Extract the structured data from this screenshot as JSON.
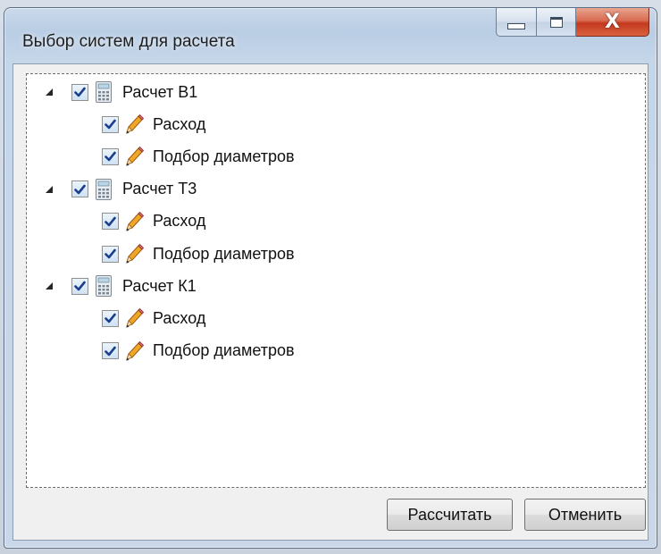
{
  "window": {
    "title": "Выбор систем для расчета"
  },
  "caption_buttons": {
    "close_glyph": "X"
  },
  "tree": {
    "nodes": [
      {
        "label": "Расчет В1",
        "expanded": true,
        "checked": true,
        "icon": "calculator-icon",
        "children": [
          {
            "label": "Расход",
            "checked": true,
            "icon": "pencil-icon"
          },
          {
            "label": "Подбор диаметров",
            "checked": true,
            "icon": "pencil-icon"
          }
        ]
      },
      {
        "label": "Расчет Т3",
        "expanded": true,
        "checked": true,
        "icon": "calculator-icon",
        "children": [
          {
            "label": "Расход",
            "checked": true,
            "icon": "pencil-icon"
          },
          {
            "label": "Подбор диаметров",
            "checked": true,
            "icon": "pencil-icon"
          }
        ]
      },
      {
        "label": "Расчет К1",
        "expanded": true,
        "checked": true,
        "icon": "calculator-icon",
        "children": [
          {
            "label": "Расход",
            "checked": true,
            "icon": "pencil-icon"
          },
          {
            "label": "Подбор диаметров",
            "checked": true,
            "icon": "pencil-icon"
          }
        ]
      }
    ]
  },
  "buttons": {
    "calculate_label": "Рассчитать",
    "cancel_label": "Отменить"
  }
}
